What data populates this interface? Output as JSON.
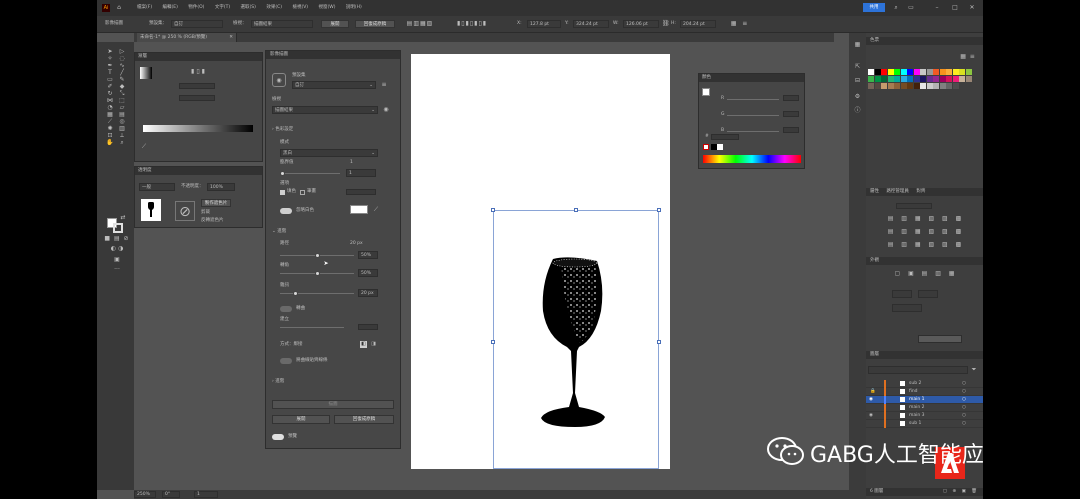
{
  "app": {
    "menu": [
      "檔案(F)",
      "編輯(E)",
      "物件(O)",
      "文字(T)",
      "選取(S)",
      "效果(C)",
      "檢視(V)",
      "視窗(W)",
      "說明(H)"
    ],
    "share_label": "共用"
  },
  "control_bar": {
    "mode_label": "影像描圖",
    "preset_label": "預設集：",
    "preset_value": "自訂",
    "view_label": "檢視：",
    "view_value": "描圖結果",
    "expand_label": "展開",
    "reset_label": "回復成原稿",
    "x_value": "127.8 pt",
    "y_value": "324.24 pt",
    "w_value": "126.06 pt",
    "h_value": "204.24 pt"
  },
  "document": {
    "tab_label": "未命名-1* @ 250 % (RGB/預覽)"
  },
  "left_panel": {
    "fill_stroke_title": "漸層",
    "transparency_title": "透明度",
    "blend_mode": "一般",
    "opacity_label": "不透明度：",
    "opacity_value": "100%",
    "make_mask_label": "製作遮色片",
    "clip_label": "剪裁",
    "invert_label": "反轉遮色片"
  },
  "trace_panel": {
    "title": "影像描圖",
    "preset_label": "預設集",
    "preset_value": "自訂",
    "view_label": "檢視",
    "view_value": "描圖結果",
    "color_section": "色彩設定",
    "mode_label": "模式",
    "mode_value": "黑白",
    "threshold_label": "臨界值",
    "threshold_value": "1",
    "threshold_value2": "1",
    "palette_label": "選項",
    "fills_label": "填色",
    "strokes_label": "筆畫",
    "ignore_white_label": "忽略白色",
    "adjust_section": "進階",
    "paths_label": "路徑",
    "paths_value": "20 px",
    "paths_pct": "50%",
    "corners_label": "轉角",
    "corners_pct": "50%",
    "noise_label": "雜訊",
    "noise_value": "20 px",
    "snap_label": "轉曲",
    "create_label": "建立",
    "method_label": "方式：鄰接",
    "overlap_label": "將曲線貼齊線條",
    "advanced_label": "進階",
    "trace_button": "描圖",
    "expand_button": "展開",
    "reset_button": "回復成原稿",
    "preview_label": "預覽",
    "paths_level": 0.5,
    "corners_level": 0.5,
    "noise_level": 0.2
  },
  "color_panel": {
    "title": "顏色",
    "r_label": "R",
    "g_label": "G",
    "b_label": "B",
    "hex_symbol": "#"
  },
  "right_panel": {
    "swatches_title": "色票",
    "properties_title": "屬性",
    "align_title": "對齊",
    "pathfinder_title": "路徑管理員",
    "transform_title": "外觀",
    "layers_title": "圖層",
    "layers": [
      {
        "name": "sub 2"
      },
      {
        "name": "find"
      },
      {
        "name": "main 1"
      },
      {
        "name": "main 2"
      },
      {
        "name": "main 3"
      },
      {
        "name": "sub 1"
      }
    ],
    "layers_count": "6 圖層"
  },
  "status": {
    "zoom": "250%",
    "angle": "0°",
    "artboard": "1"
  },
  "watermark": {
    "text": "GABG人工智能应用"
  },
  "colors": {
    "accent": "#2d73d9",
    "bg": "#535353",
    "panel": "#464646",
    "selection": "#2e5aa8"
  }
}
